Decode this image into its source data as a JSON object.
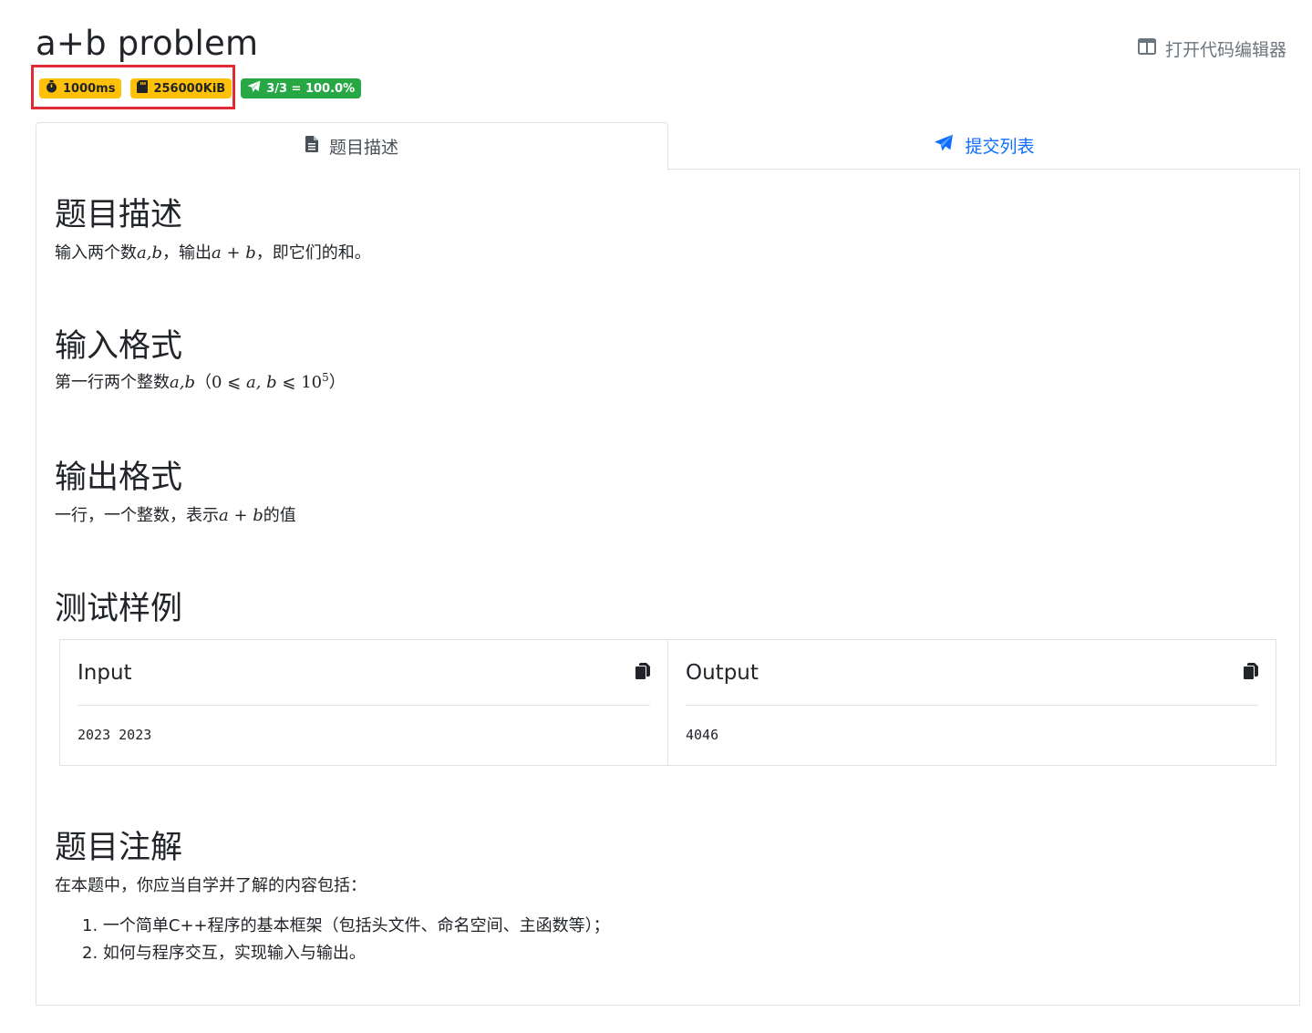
{
  "problem": {
    "title": "a+b problem",
    "editor_link": "打开代码编辑器",
    "badges": {
      "time_limit": "1000ms",
      "memory_limit": "256000KiB",
      "accepted": "3/3 = 100.0%"
    }
  },
  "tabs": [
    {
      "label": "题目描述",
      "icon": "file-icon",
      "active": true
    },
    {
      "label": "提交列表",
      "icon": "paper-plane-icon",
      "active": false
    }
  ],
  "sections": {
    "description": {
      "title": "题目描述",
      "p1": "输入两个数",
      "m1": "a,b",
      "p2": "，输出",
      "m2": "a + b",
      "p3": "，即它们的和。"
    },
    "input_format": {
      "title": "输入格式",
      "p1": "第一行两个整数",
      "m1": "a,b",
      "lparen": "（",
      "m2a": "0 ⩽ ",
      "m2b": "a, b",
      "m2c": " ⩽ 10",
      "m2sup": "5",
      "rparen": "）"
    },
    "output_format": {
      "title": "输出格式",
      "p1": "一行，一个整数，表示",
      "m1": "a + b",
      "p2": "的值"
    },
    "samples": {
      "title": "测试样例",
      "input_label": "Input",
      "output_label": "Output",
      "input_value": "2023 2023",
      "output_value": "4046"
    },
    "notes": {
      "title": "题目注解",
      "intro": "在本题中，你应当自学并了解的内容包括：",
      "items": [
        "1. 一个简单C++程序的基本框架（包括头文件、命名空间、主函数等）；",
        "2. 如何与程序交互，实现输入与输出。"
      ]
    }
  },
  "colors": {
    "warning_badge": "#ffc107",
    "success_badge": "#28a745",
    "link_blue": "#0d6efd",
    "highlight_red": "#e02a35"
  }
}
